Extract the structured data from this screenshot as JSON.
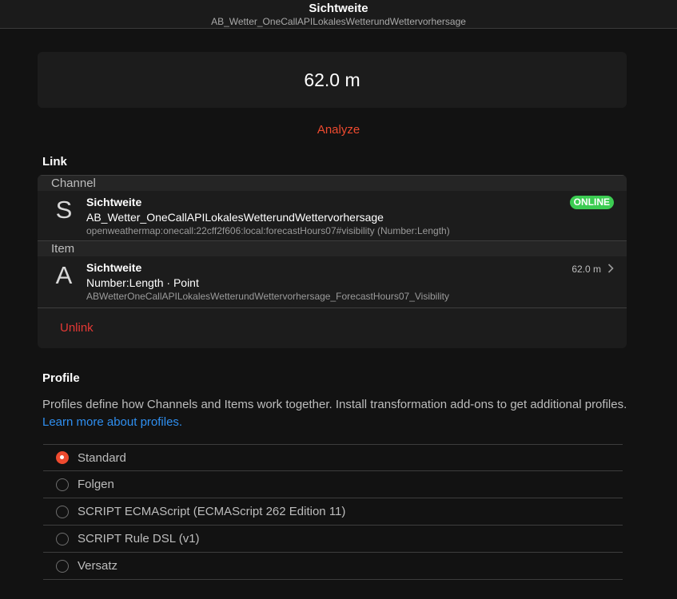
{
  "navbar": {
    "title": "Sichtweite",
    "subtitle": "AB_Wetter_OneCallAPILokalesWetterundWettervorhersage"
  },
  "state": {
    "value": "62.0 m"
  },
  "analyze_label": "Analyze",
  "link": {
    "title": "Link",
    "channel_group": "Channel",
    "channel": {
      "avatar": "S",
      "title": "Sichtweite",
      "subtitle": "AB_Wetter_OneCallAPILokalesWetterundWettervorhersage",
      "footer": "openweathermap:onecall:22cff2f606:local:forecastHours07#visibility (Number:Length)",
      "status": "ONLINE",
      "status_color": "#3ccc52"
    },
    "item_group": "Item",
    "item": {
      "avatar": "A",
      "title": "Sichtweite",
      "subtitle": "Number:Length · Point",
      "footer": "ABWetterOneCallAPILokalesWetterundWettervorhersage_ForecastHours07_Visibility",
      "state": "62.0 m",
      "chevron": "chevron-right-icon"
    },
    "unlink_label": "Unlink"
  },
  "profile": {
    "title": "Profile",
    "description": "Profiles define how Channels and Items work together. Install transformation add-ons to get additional profiles.",
    "learn_more": "Learn more about profiles.",
    "options": [
      {
        "label": "Standard",
        "checked": true
      },
      {
        "label": "Folgen",
        "checked": false
      },
      {
        "label": "SCRIPT ECMAScript (ECMAScript 262 Edition 11)",
        "checked": false
      },
      {
        "label": "SCRIPT Rule DSL (v1)",
        "checked": false
      },
      {
        "label": "Versatz",
        "checked": false
      }
    ]
  },
  "colors": {
    "accent": "#ee4a2f",
    "link": "#2f8ff0",
    "danger": "#e53935"
  }
}
